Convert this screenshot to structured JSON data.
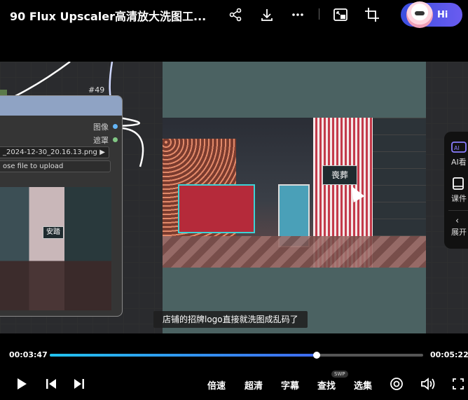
{
  "header": {
    "title": "90 Flux Upscaler高清放大洗图工...",
    "icons": [
      "share-icon",
      "download-icon",
      "more-icon",
      "pip-icon",
      "crop-icon"
    ],
    "assistant_label": "Hi"
  },
  "node": {
    "tag": "#49",
    "outputs": [
      "图像",
      "遮罩"
    ],
    "filename": "_2024-12-30_20.16.13.png",
    "upload_label": "ose file to upload",
    "thumb_sign": "安踏"
  },
  "storefront": {
    "sign": "喪葬"
  },
  "side_panel": {
    "ai_label": "AI看",
    "notes_label": "课件",
    "expand_label": "展开"
  },
  "subtitle": "店铺的招牌logo直接就洗图成乱码了",
  "player": {
    "current_time": "00:03:47",
    "total_time": "00:05:22",
    "progress": 0.715,
    "controls": {
      "speed": "倍速",
      "quality": "超清",
      "captions": "字幕",
      "find": "查找",
      "find_badge": "SWP",
      "episodes": "选集"
    }
  }
}
